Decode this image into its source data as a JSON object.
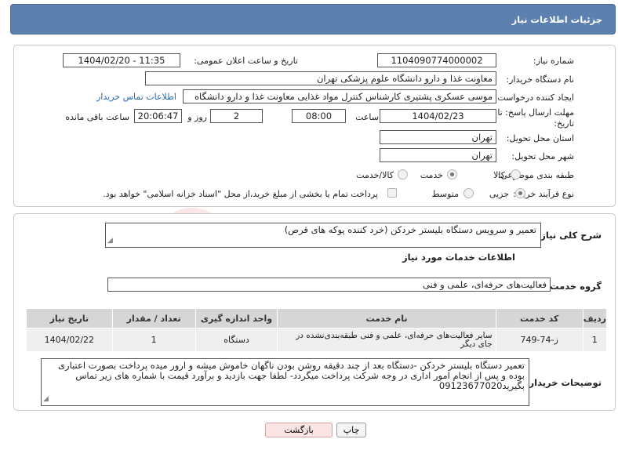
{
  "header": {
    "title": "جزئیات اطلاعات نیاز"
  },
  "form": {
    "need_number_label": "شماره نیاز:",
    "need_number": "1104090774000002",
    "announce_label": "تاریخ و ساعت اعلان عمومی:",
    "announce_value": "1404/02/20 - 11:35",
    "buyer_org_label": "نام دستگاه خریدار:",
    "buyer_org": "معاونت غذا و دارو دانشگاه علوم پزشکی تهران",
    "creator_label": "ایجاد کننده درخواست:",
    "creator": "موسی  عسکری پشتیری  کارشناس کنترل مواد غذایی معاونت غذا و دارو دانشگاه",
    "contact_link": "اطلاعات تماس خریدار",
    "deadline_label": "مهلت ارسال پاسخ: تا تاریخ:",
    "deadline_date": "1404/02/23",
    "time_label": "ساعت",
    "deadline_time": "08:00",
    "days_value": "2",
    "days_label": "روز و",
    "remaining_time": "20:06:47",
    "remaining_label": "ساعت باقی مانده",
    "province_label": "استان محل تحویل:",
    "province": "تهران",
    "city_label": "شهر محل تحویل:",
    "city": "تهران",
    "category_label": "طبقه بندی موضوعی:",
    "category_options": [
      "کالا",
      "خدمت",
      "کالا/خدمت"
    ],
    "purchase_type_label": "نوع فرآیند خرید :",
    "purchase_options": [
      "جزیی",
      "متوسط"
    ],
    "payment_note": "پرداخت تمام یا بخشی از مبلغ خرید،از محل \"اسناد خزانه اسلامی\" خواهد بود."
  },
  "need": {
    "summary_label": "شرح کلی نیاز:",
    "summary": "تعمیر و سرویس دستگاه بلیستر خردکن (خرد کننده پوکه های قرص)",
    "services_heading": "اطلاعات خدمات مورد نیاز",
    "service_group_label": "گروه خدمت:",
    "service_group": "فعالیت‌های حرفه‌ای، علمی و فنی",
    "table": {
      "headers": [
        "ردیف",
        "کد خدمت",
        "نام خدمت",
        "واحد اندازه گیری",
        "تعداد / مقدار",
        "تاریخ نیاز"
      ],
      "rows": [
        [
          "1",
          "ز-74-749",
          "سایر فعالیت‌های حرفه‌ای، علمی و فنی طبقه‌بندی‌نشده در جای دیگر",
          "دستگاه",
          "1",
          "1404/02/22"
        ]
      ]
    },
    "buyer_notes_label": "توضیحات خریدار:",
    "buyer_notes": "تعمیر دستگاه بلیستر خردکن -دستگاه بعد از چند دقیقه روشن بودن ناگهان خاموش میشه و ارور میده پرداخت بصورت اعتباری بوده و پس از انجام امور اداری در وجه شرکت پرداخت میگردد- لطفا جهت بازدید و برآورد قیمت با شماره های زیر تماس بگیرید09123677020"
  },
  "buttons": {
    "print": "چاپ",
    "back": "بازگشت"
  },
  "watermark": "AriaTender.neT"
}
